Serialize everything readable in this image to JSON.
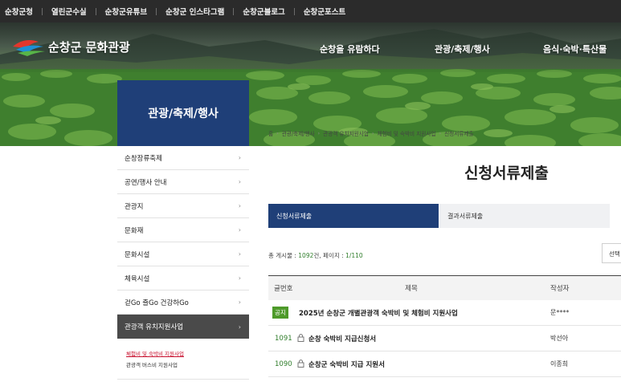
{
  "topbar": {
    "links": [
      "순창군청",
      "열린군수실",
      "순창군유튜브",
      "순창군 인스타그램",
      "순창군블로그",
      "순창군포스트"
    ]
  },
  "header": {
    "logo_text": "순창군 문화관광",
    "nav": [
      "순창을 유람하다",
      "관광/축제/행사",
      "음식·숙박·특산물"
    ]
  },
  "section": {
    "title": "관광/축제/행사"
  },
  "breadcrumb": [
    "홈",
    "관광/축제/행사",
    "관광객 유치지원사업",
    "체험비 및 숙박비 지원사업",
    "신청서류제출"
  ],
  "sidebar": {
    "items": [
      {
        "label": "순창장류축제"
      },
      {
        "label": "공연/행사 안내"
      },
      {
        "label": "관광지"
      },
      {
        "label": "문화재"
      },
      {
        "label": "문화시설"
      },
      {
        "label": "체육시설"
      },
      {
        "label": "걷Go 즐Go 건강하Go"
      },
      {
        "label": "관광객 유치지원사업"
      }
    ],
    "submenu": [
      "체험비 및 숙박비 지원사업",
      "관광객 버스비 지원사업"
    ]
  },
  "main": {
    "title": "신청서류제출",
    "tabs": [
      "신청서류제출",
      "결과서류제출"
    ],
    "count": {
      "prefix": "총 게시물 : ",
      "total": "1092",
      "mid": "건, 페이지 : ",
      "page": "1/110"
    },
    "select_label": "선택"
  },
  "board": {
    "headers": {
      "no": "글번호",
      "title": "제목",
      "author": "작성자"
    },
    "rows": [
      {
        "no": "공지",
        "title": "2025년 순창군 개별관광객 숙박비 및 체험비 지원사업",
        "author": "문****"
      },
      {
        "no": "1091",
        "title": "순창 숙박비 지급신청서",
        "author": "박선아"
      },
      {
        "no": "1090",
        "title": "순창군 숙박비 지급 지원서",
        "author": "이종희"
      }
    ]
  },
  "colors": {
    "navy": "#1f3f78",
    "green": "#4e9a2a",
    "dark": "#2b2b2b",
    "active_menu": "#4a4a4a"
  }
}
